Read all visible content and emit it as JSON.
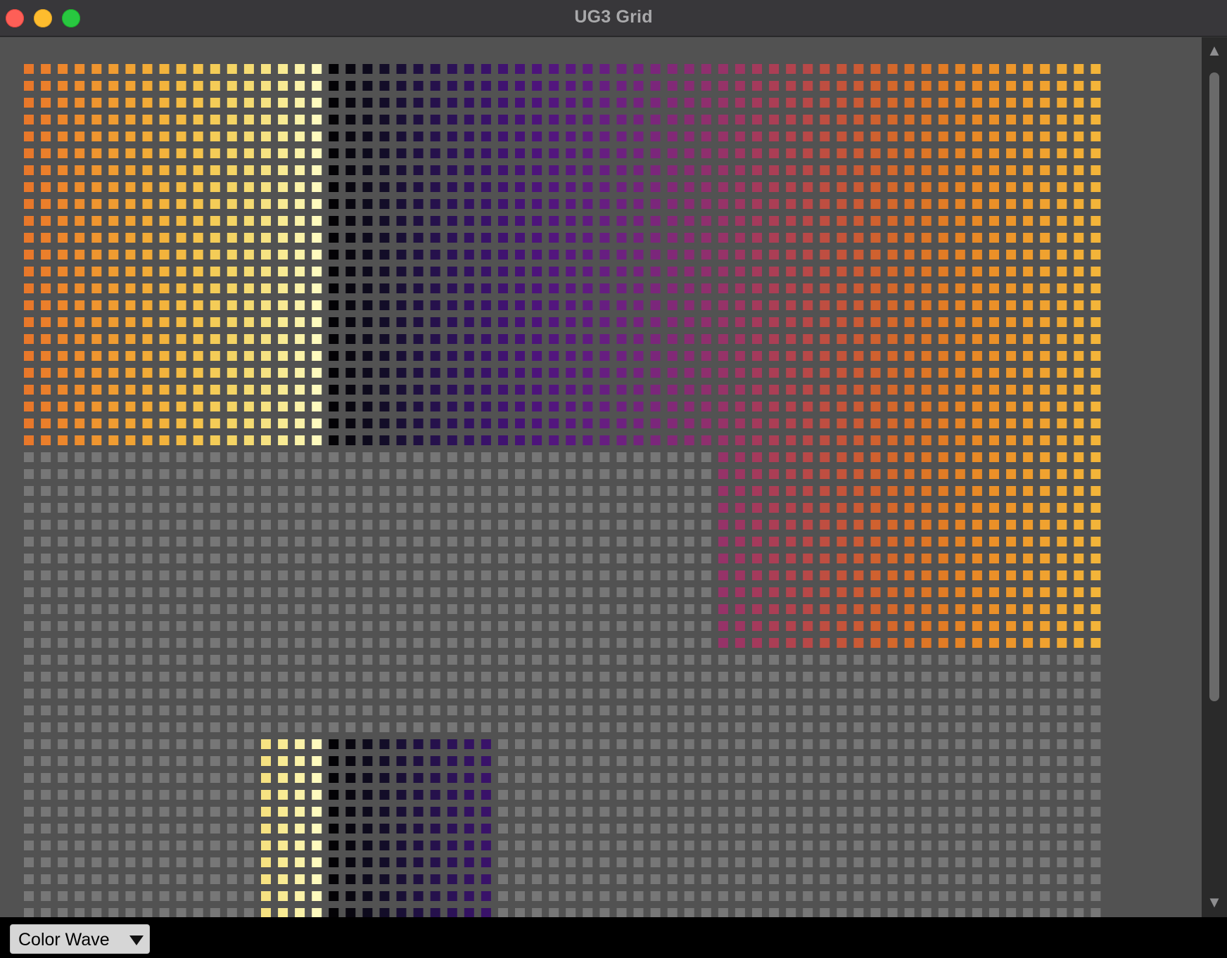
{
  "window": {
    "title": "UG3 Grid"
  },
  "bottom_bar": {
    "selected_mode": "Color Wave"
  },
  "grid": {
    "columns": 64,
    "rows_visible": 51,
    "inactive_color": "#777777",
    "background_color": "#525252",
    "column_colors": [
      "#e8782a",
      "#eb7f2b",
      "#ed872c",
      "#ee8d2d",
      "#ef952f",
      "#f09c31",
      "#f1a333",
      "#f2ab37",
      "#f3b33c",
      "#f4bb43",
      "#f4c34c",
      "#f4cc57",
      "#f4d464",
      "#f5db72",
      "#f6e282",
      "#f8ea93",
      "#fbf2a8",
      "#fefabe",
      "#030205",
      "#08060f",
      "#0d0a1c",
      "#130d28",
      "#190f35",
      "#1f1041",
      "#26114c",
      "#2c1257",
      "#331261",
      "#391269",
      "#401370",
      "#461376",
      "#4d147b",
      "#53167e",
      "#5a1880",
      "#601b81",
      "#671e81",
      "#6e2180",
      "#74237e",
      "#7b267b",
      "#822977",
      "#882c73",
      "#8f2f6e",
      "#963368",
      "#9d3662",
      "#a43a5c",
      "#ab3e55",
      "#b2434e",
      "#b84848",
      "#bf4e41",
      "#c5543a",
      "#cb5a35",
      "#d0612f",
      "#d5682b",
      "#da6f28",
      "#de7626",
      "#e27c25",
      "#e58325",
      "#e88926",
      "#eb9028",
      "#ed962a",
      "#ef9c2c",
      "#f0a22f",
      "#f1a832",
      "#f2ae35",
      "#f3b439"
    ],
    "active_regions": [
      {
        "col_start": 0,
        "col_end": 63,
        "row_start": 0,
        "row_end": 22
      },
      {
        "col_start": 41,
        "col_end": 63,
        "row_start": 23,
        "row_end": 34
      },
      {
        "col_start": 14,
        "col_end": 27,
        "row_start": 40,
        "row_end": 50
      }
    ]
  }
}
